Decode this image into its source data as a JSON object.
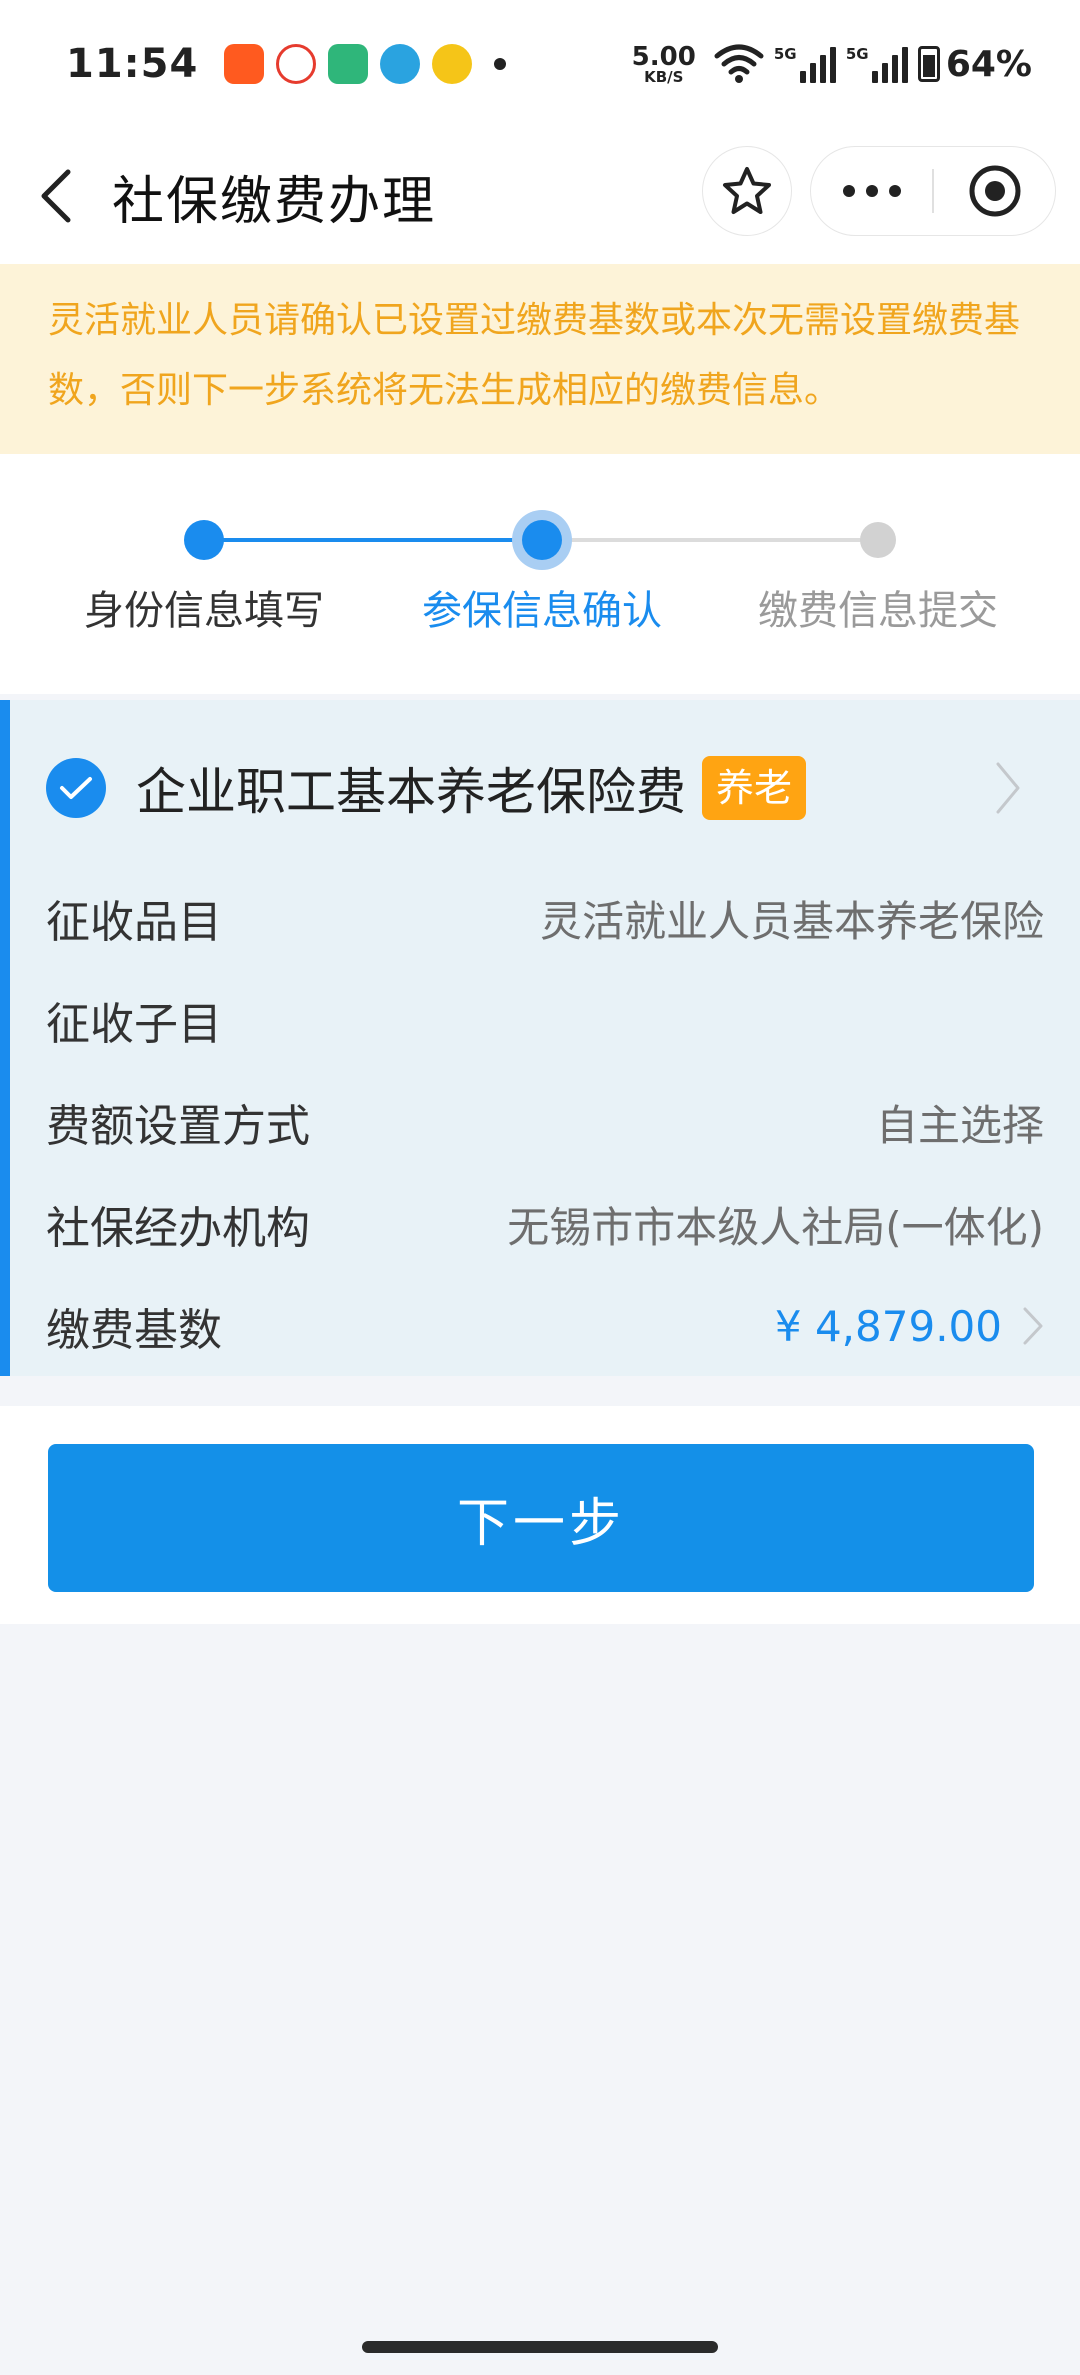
{
  "status_bar": {
    "time": "11:54",
    "net_speed_value": "5.00",
    "net_speed_unit": "KB/S",
    "sim1_label": "5G",
    "sim2_label": "5G",
    "battery": "64%",
    "notification_icons": [
      "kuaishou-icon",
      "weibo-icon",
      "home-app-icon",
      "telegram-icon",
      "pet-app-icon"
    ]
  },
  "nav": {
    "title": "社保缴费办理"
  },
  "notice": {
    "text": "灵活就业人员请确认已设置过缴费基数或本次无需设置缴费基数，否则下一步系统将无法生成相应的缴费信息。"
  },
  "steps": {
    "current": 2,
    "items": [
      {
        "label": "身份信息填写",
        "state": "done"
      },
      {
        "label": "参保信息确认",
        "state": "active"
      },
      {
        "label": "缴费信息提交",
        "state": "pending"
      }
    ]
  },
  "card": {
    "checked": true,
    "title": "企业职工基本养老保险费",
    "badge": "养老",
    "rows": [
      {
        "label": "征收品目",
        "value": "灵活就业人员基本养老保险"
      },
      {
        "label": "征收子目",
        "value": ""
      },
      {
        "label": "费额设置方式",
        "value": "自主选择"
      },
      {
        "label": "社保经办机构",
        "value": "无锡市市本级人社局(一体化)"
      },
      {
        "label": "缴费基数",
        "value": "¥ 4,879.00"
      }
    ]
  },
  "actions": {
    "next_label": "下一步"
  },
  "colors": {
    "primary": "#1a8cee",
    "notice_bg": "#fdf3d8",
    "notice_text": "#f0a51e",
    "badge": "#ffa412",
    "card_bg": "#e8f2f7"
  }
}
